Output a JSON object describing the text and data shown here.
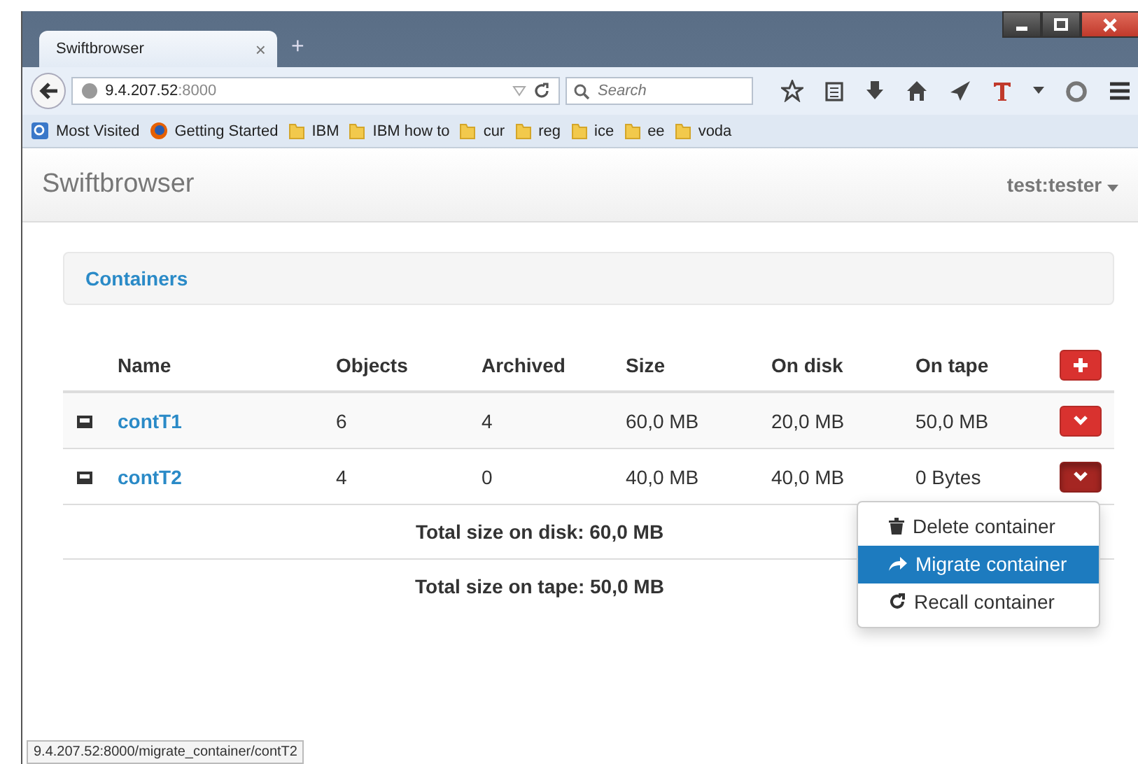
{
  "browser": {
    "tab": {
      "title": "Swiftbrowser",
      "close": "×",
      "selected": true
    },
    "new_tab": "+",
    "address": {
      "host": "9.4.207.52",
      "port": ":8000"
    },
    "search": {
      "placeholder": "Search"
    },
    "bookmarks": [
      {
        "label": "Most Visited",
        "kind": "visited"
      },
      {
        "label": "Getting Started",
        "kind": "firefox"
      },
      {
        "label": "IBM",
        "kind": "folder"
      },
      {
        "label": "IBM how to",
        "kind": "folder"
      },
      {
        "label": "cur",
        "kind": "folder"
      },
      {
        "label": "reg",
        "kind": "folder"
      },
      {
        "label": "ice",
        "kind": "folder"
      },
      {
        "label": "ee",
        "kind": "folder"
      },
      {
        "label": "voda",
        "kind": "folder"
      }
    ],
    "status_url": "9.4.207.52:8000/migrate_container/contT2"
  },
  "navbar": {
    "brand": "Swiftbrowser",
    "user": "test:tester"
  },
  "panel": {
    "title": "Containers"
  },
  "table": {
    "columns": [
      "Name",
      "Objects",
      "Archived",
      "Size",
      "On disk",
      "On tape"
    ],
    "rows": [
      {
        "name": "contT1",
        "objects": "6",
        "archived": "4",
        "size": "60,0 MB",
        "on_disk": "20,0 MB",
        "on_tape": "50,0 MB",
        "menu_open": false
      },
      {
        "name": "contT2",
        "objects": "4",
        "archived": "0",
        "size": "40,0 MB",
        "on_disk": "40,0 MB",
        "on_tape": "0 Bytes",
        "menu_open": true
      }
    ],
    "totals": [
      "Total size on disk: 60,0 MB",
      "Total size on tape: 50,0 MB"
    ]
  },
  "dropdown": {
    "items": [
      {
        "label": "Delete container",
        "kind": "trash",
        "selected": false
      },
      {
        "label": "Migrate container",
        "kind": "share",
        "selected": true
      },
      {
        "label": "Recall container",
        "kind": "refresh",
        "selected": false
      }
    ]
  }
}
